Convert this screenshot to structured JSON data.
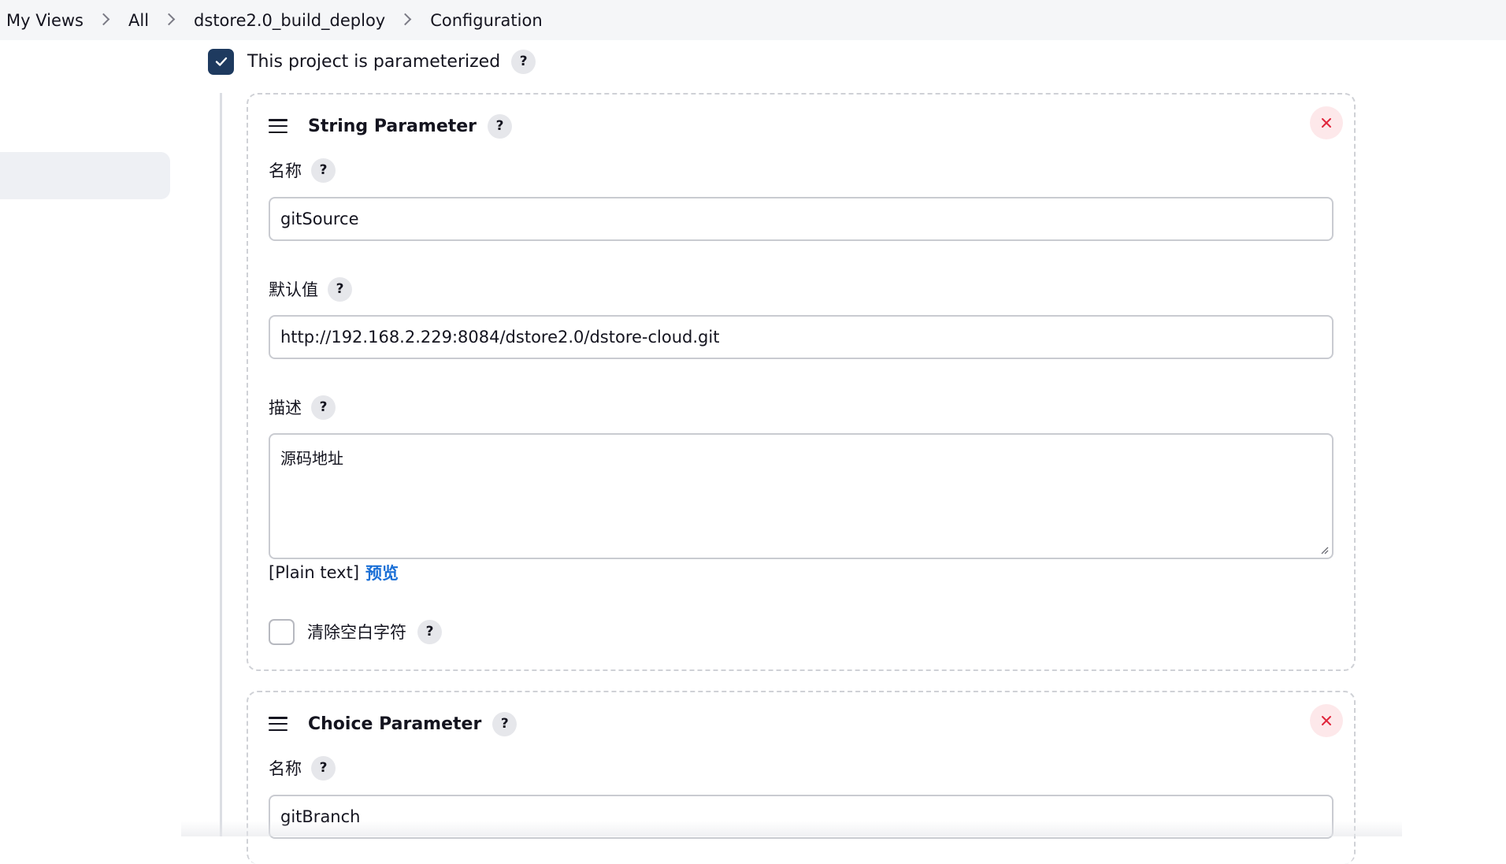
{
  "breadcrumb": {
    "items": [
      "My Views",
      "All",
      "dstore2.0_build_deploy",
      "Configuration"
    ]
  },
  "parameterized": {
    "label": "This project is parameterized",
    "checked": true,
    "help": "?"
  },
  "string_parameter": {
    "title": "String Parameter",
    "help": "?",
    "name_label": "名称",
    "name_value": "gitSource",
    "default_label": "默认值",
    "default_value": "http://192.168.2.229:8084/dstore2.0/dstore-cloud.git",
    "description_label": "描述",
    "description_value": "源码地址",
    "markup_text": "[Plain text]",
    "preview_link": "预览",
    "trim_label": "清除空白字符",
    "trim_checked": false
  },
  "choice_parameter": {
    "title": "Choice Parameter",
    "help": "?",
    "name_label": "名称",
    "name_value": "gitBranch"
  },
  "colors": {
    "checkbox_accent": "#1e3a5f",
    "link": "#1a6fd6",
    "close_bg": "#fde8ea",
    "close_icon": "#e0253b"
  }
}
